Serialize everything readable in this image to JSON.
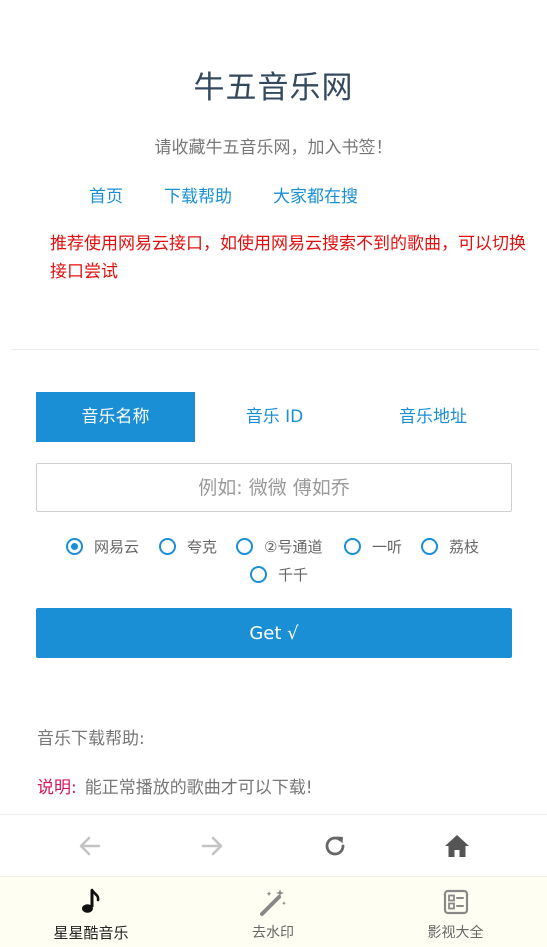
{
  "header": {
    "title": "牛五音乐网",
    "subtitle": "请收藏牛五音乐网，加入书签！"
  },
  "nav": {
    "links": [
      "首页",
      "下载帮助",
      "大家都在搜"
    ]
  },
  "notice": "推荐使用网易云接口，如使用网易云搜索不到的歌曲，可以切换接口尝试",
  "tabs": [
    "音乐名称",
    "音乐 ID",
    "音乐地址"
  ],
  "search": {
    "value": "",
    "placeholder": "例如: 微微 傅如乔"
  },
  "sources": {
    "options": [
      "网易云",
      "夸克",
      "②号通道",
      "一听",
      "荔枝",
      "千千"
    ],
    "selected": "网易云"
  },
  "get_button": "Get √",
  "help": {
    "title": "音乐下载帮助:",
    "note_label": "说明:",
    "note_text": "能正常播放的歌曲才可以下载!"
  },
  "browser_bar": {
    "icons": [
      "back-arrow-icon",
      "forward-arrow-icon",
      "refresh-icon",
      "home-icon"
    ]
  },
  "tabbar": {
    "items": [
      {
        "label": "星星酷音乐",
        "icon": "music-note-icon",
        "active": true
      },
      {
        "label": "去水印",
        "icon": "magic-wand-icon",
        "active": false
      },
      {
        "label": "影视大全",
        "icon": "grid-list-icon",
        "active": false
      }
    ]
  },
  "colors": {
    "accent": "#1a8fd6",
    "notice": "#e01010",
    "note_label": "#d6145a",
    "title": "#34495e",
    "tabbar_bg": "#fffef3"
  }
}
